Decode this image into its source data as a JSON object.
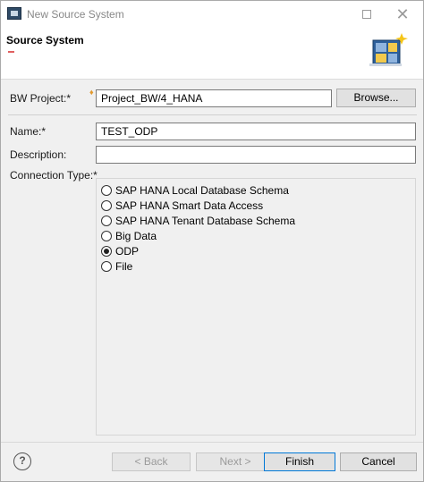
{
  "window": {
    "title": "New Source System",
    "close_glyph": "✕"
  },
  "banner": {
    "title": "Source System",
    "icon": "wizard-database-icon"
  },
  "form": {
    "bw_project_label": "BW Project:*",
    "bw_project_value": "Project_BW/4_HANA",
    "browse_label": "Browse...",
    "name_label": "Name:*",
    "name_value": "TEST_ODP",
    "description_label": "Description:",
    "description_value": "",
    "connection_type_label": "Connection Type:*",
    "connection_types": [
      {
        "label": "SAP HANA Local Database Schema",
        "checked": false
      },
      {
        "label": "SAP HANA Smart Data Access",
        "checked": false
      },
      {
        "label": "SAP HANA Tenant Database Schema",
        "checked": false
      },
      {
        "label": "Big Data",
        "checked": false
      },
      {
        "label": "ODP",
        "checked": true
      },
      {
        "label": "File",
        "checked": false
      }
    ]
  },
  "footer": {
    "help_label": "?",
    "back_label": "< Back",
    "next_label": "Next >",
    "finish_label": "Finish",
    "cancel_label": "Cancel"
  },
  "colors": {
    "accent": "#0078d7",
    "warning_marker": "#e29a2f"
  }
}
